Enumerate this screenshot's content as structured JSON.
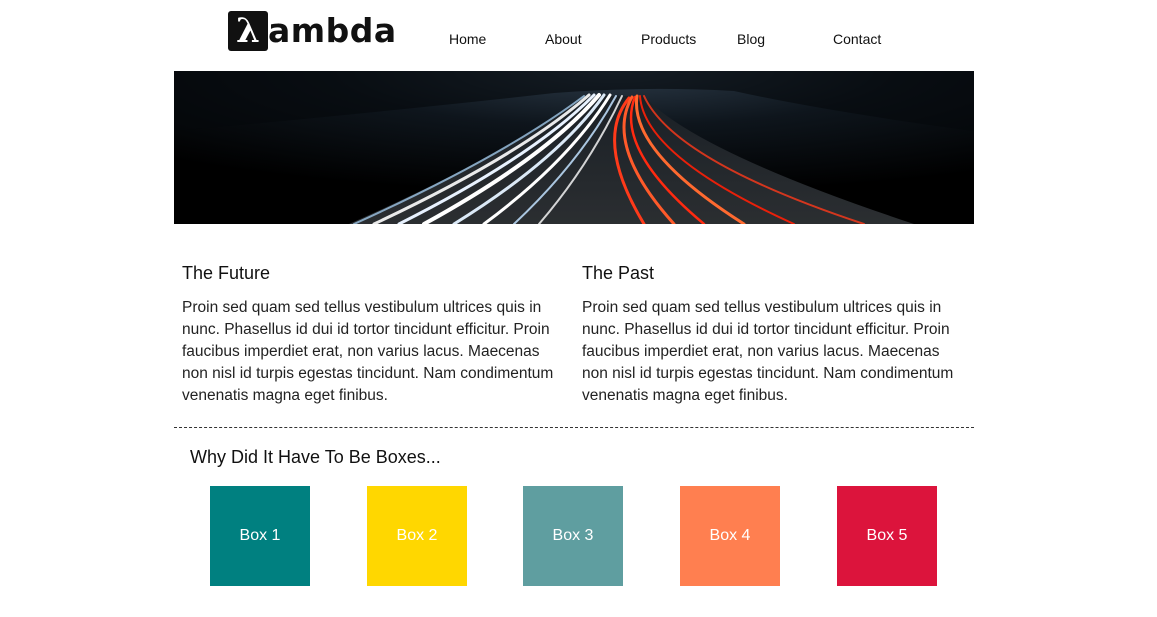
{
  "brand": {
    "logo_mark": "λ",
    "logo_text": "ambda"
  },
  "nav": {
    "items": [
      {
        "label": "Home"
      },
      {
        "label": "About"
      },
      {
        "label": "Products"
      },
      {
        "label": "Blog"
      },
      {
        "label": "Contact"
      }
    ]
  },
  "hero": {
    "image": "highway-light-trails"
  },
  "sections": [
    {
      "title": "The Future",
      "body": "Proin sed quam sed tellus vestibulum ultrices quis in nunc. Phasellus id dui id tortor tincidunt efficitur. Proin faucibus imperdiet erat, non varius lacus. Maecenas non nisl id turpis egestas tincidunt. Nam condimentum venenatis magna eget finibus."
    },
    {
      "title": "The Past",
      "body": "Proin sed quam sed tellus vestibulum ultrices quis in nunc. Phasellus id dui id tortor tincidunt efficitur. Proin faucibus imperdiet erat, non varius lacus. Maecenas non nisl id turpis egestas tincidunt. Nam condimentum venenatis magna eget finibus."
    }
  ],
  "boxes": {
    "title": "Why Did It Have To Be Boxes...",
    "items": [
      {
        "label": "Box 1",
        "color": "#008080"
      },
      {
        "label": "Box 2",
        "color": "#FFD700"
      },
      {
        "label": "Box 3",
        "color": "#5F9EA0"
      },
      {
        "label": "Box 4",
        "color": "#FF7F50"
      },
      {
        "label": "Box 5",
        "color": "#DC143C"
      }
    ]
  }
}
